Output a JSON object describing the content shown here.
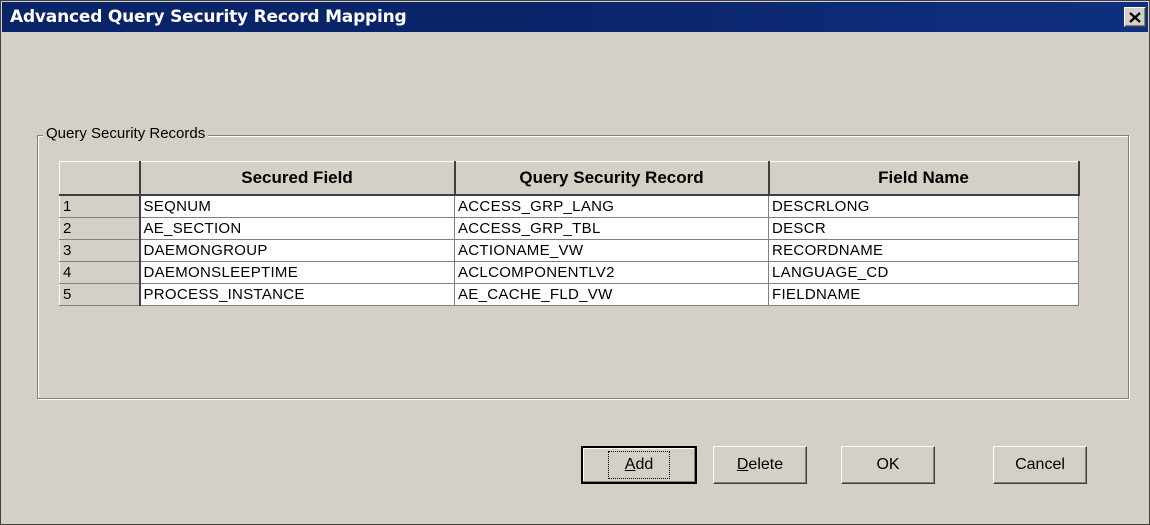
{
  "window": {
    "title": "Advanced Query Security Record Mapping",
    "close_label": "✕"
  },
  "group": {
    "label": "Query Security Records"
  },
  "grid": {
    "columns": [
      "",
      "Secured Field",
      "Query Security Record",
      "Field Name"
    ],
    "rows": [
      {
        "num": "1",
        "secured_field": "SEQNUM",
        "query_security_record": "ACCESS_GRP_LANG",
        "field_name": "DESCRLONG"
      },
      {
        "num": "2",
        "secured_field": "AE_SECTION",
        "query_security_record": "ACCESS_GRP_TBL",
        "field_name": "DESCR"
      },
      {
        "num": "3",
        "secured_field": "DAEMONGROUP",
        "query_security_record": "ACTIONAME_VW",
        "field_name": "RECORDNAME"
      },
      {
        "num": "4",
        "secured_field": "DAEMONSLEEPTIME",
        "query_security_record": "ACLCOMPONENTLV2",
        "field_name": "LANGUAGE_CD"
      },
      {
        "num": "5",
        "secured_field": "PROCESS_INSTANCE",
        "query_security_record": "AE_CACHE_FLD_VW",
        "field_name": "FIELDNAME"
      }
    ]
  },
  "buttons": {
    "add_mnemonic": "A",
    "add_rest": "dd",
    "delete_mnemonic": "D",
    "delete_rest": "elete",
    "ok": "OK",
    "cancel": "Cancel"
  }
}
